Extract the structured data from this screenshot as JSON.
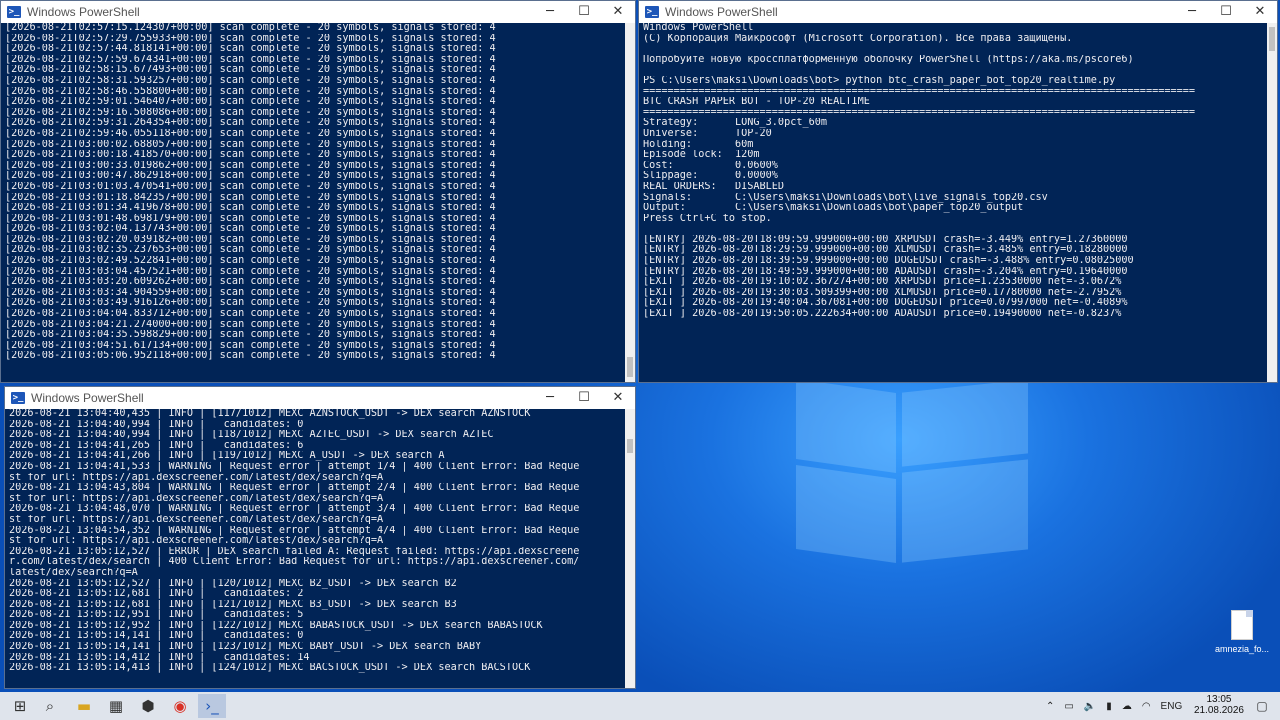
{
  "windows": {
    "w1": {
      "title": "Windows PowerShell",
      "lines": [
        "[2026-08-21T02:57:15.124307+00:00] scan complete - 20 symbols, signals stored: 4",
        "[2026-08-21T02:57:29.755933+00:00] scan complete - 20 symbols, signals stored: 4",
        "[2026-08-21T02:57:44.818141+00:00] scan complete - 20 symbols, signals stored: 4",
        "[2026-08-21T02:57:59.674341+00:00] scan complete - 20 symbols, signals stored: 4",
        "[2026-08-21T02:58:15.677493+00:00] scan complete - 20 symbols, signals stored: 4",
        "[2026-08-21T02:58:31.593257+00:00] scan complete - 20 symbols, signals stored: 4",
        "[2026-08-21T02:58:46.558800+00:00] scan complete - 20 symbols, signals stored: 4",
        "[2026-08-21T02:59:01.546407+00:00] scan complete - 20 symbols, signals stored: 4",
        "[2026-08-21T02:59:16.508086+00:00] scan complete - 20 symbols, signals stored: 4",
        "[2026-08-21T02:59:31.264354+00:00] scan complete - 20 symbols, signals stored: 4",
        "[2026-08-21T02:59:46.055118+00:00] scan complete - 20 symbols, signals stored: 4",
        "[2026-08-21T03:00:02.688057+00:00] scan complete - 20 symbols, signals stored: 4",
        "[2026-08-21T03:00:18.418570+00:00] scan complete - 20 symbols, signals stored: 4",
        "[2026-08-21T03:00:33.019862+00:00] scan complete - 20 symbols, signals stored: 4",
        "[2026-08-21T03:00:47.862918+00:00] scan complete - 20 symbols, signals stored: 4",
        "[2026-08-21T03:01:03.470541+00:00] scan complete - 20 symbols, signals stored: 4",
        "[2026-08-21T03:01:18.842357+00:00] scan complete - 20 symbols, signals stored: 4",
        "[2026-08-21T03:01:34.419678+00:00] scan complete - 20 symbols, signals stored: 4",
        "[2026-08-21T03:01:48.698179+00:00] scan complete - 20 symbols, signals stored: 4",
        "[2026-08-21T03:02:04.137743+00:00] scan complete - 20 symbols, signals stored: 4",
        "[2026-08-21T03:02:20.039182+00:00] scan complete - 20 symbols, signals stored: 4",
        "[2026-08-21T03:02:35.237653+00:00] scan complete - 20 symbols, signals stored: 4",
        "[2026-08-21T03:02:49.522841+00:00] scan complete - 20 symbols, signals stored: 4",
        "[2026-08-21T03:03:04.457521+00:00] scan complete - 20 symbols, signals stored: 4",
        "[2026-08-21T03:03:20.609262+00:00] scan complete - 20 symbols, signals stored: 4",
        "[2026-08-21T03:03:34.904559+00:00] scan complete - 20 symbols, signals stored: 4",
        "[2026-08-21T03:03:49.916126+00:00] scan complete - 20 symbols, signals stored: 4",
        "[2026-08-21T03:04:04.833712+00:00] scan complete - 20 symbols, signals stored: 4",
        "[2026-08-21T03:04:21.274000+00:00] scan complete - 20 symbols, signals stored: 4",
        "[2026-08-21T03:04:35.598829+00:00] scan complete - 20 symbols, signals stored: 4",
        "[2026-08-21T03:04:51.617134+00:00] scan complete - 20 symbols, signals stored: 4",
        "[2026-08-21T03:05:06.952118+00:00] scan complete - 20 symbols, signals stored: 4"
      ]
    },
    "w2": {
      "title": "Windows PowerShell",
      "lines": [
        "Windows PowerShell",
        "(C) Корпорация Майкрософт (Microsoft Corporation). Все права защищены.",
        "",
        "Попробуйте новую кроссплатформенную оболочку PowerShell (https://aka.ms/pscore6)",
        "",
        "PS C:\\Users\\maksi\\Downloads\\bot> python btc_crash_paper_bot_top20_realtime.py",
        "==========================================================================================",
        "BTC CRASH PAPER BOT - TOP-20 REALTIME",
        "==========================================================================================",
        "Strategy:      LONG_3.0pct_60m",
        "Universe:      TOP-20",
        "Holding:       60m",
        "Episode lock:  120m",
        "Cost:          0.0600%",
        "Slippage:      0.0000%",
        "REAL ORDERS:   DISABLED",
        "Signals:       C:\\Users\\maksi\\Downloads\\bot\\live_signals_top20.csv",
        "Output:        C:\\Users\\maksi\\Downloads\\bot\\paper_top20_output",
        "Press Ctrl+C to stop.",
        "",
        "[ENTRY] 2026-08-20T18:09:59.999000+00:00 XRPUSDT crash=-3.449% entry=1.27360000",
        "[ENTRY] 2026-08-20T18:29:59.999000+00:00 XLMUSDT crash=-3.485% entry=0.18280000",
        "[ENTRY] 2026-08-20T18:39:59.999000+00:00 DOGEUSDT crash=-3.488% entry=0.08025000",
        "[ENTRY] 2026-08-20T18:49:59.999000+00:00 ADAUSDT crash=-3.204% entry=0.19640000",
        "[EXIT ] 2026-08-20T19:10:02.367274+00:00 XRPUSDT price=1.23530000 net=-3.0672%",
        "[EXIT ] 2026-08-20T19:30:03.509399+00:00 XLMUSDT price=0.17780000 net=-2.7952%",
        "[EXIT ] 2026-08-20T19:40:04.367081+00:00 DOGEUSDT price=0.07997000 net=-0.4089%",
        "[EXIT ] 2026-08-20T19:50:05.222634+00:00 ADAUSDT price=0.19490000 net=-0.8237%"
      ]
    },
    "w3": {
      "title": "Windows PowerShell",
      "lines": [
        "2026-08-21 13:04:40,435 | INFO | [117/1012] MEXC AZNSTOCK_USDT -> DEX search AZNSTOCK",
        "2026-08-21 13:04:40,994 | INFO |   candidates: 0",
        "2026-08-21 13:04:40,994 | INFO | [118/1012] MEXC AZTEC_USDT -> DEX search AZTEC",
        "2026-08-21 13:04:41,265 | INFO |   candidates: 6",
        "2026-08-21 13:04:41,266 | INFO | [119/1012] MEXC A_USDT -> DEX search A",
        "2026-08-21 13:04:41,533 | WARNING | Request error | attempt 1/4 | 400 Client Error: Bad Reque",
        "st for url: https://api.dexscreener.com/latest/dex/search?q=A",
        "2026-08-21 13:04:43,804 | WARNING | Request error | attempt 2/4 | 400 Client Error: Bad Reque",
        "st for url: https://api.dexscreener.com/latest/dex/search?q=A",
        "2026-08-21 13:04:48,070 | WARNING | Request error | attempt 3/4 | 400 Client Error: Bad Reque",
        "st for url: https://api.dexscreener.com/latest/dex/search?q=A",
        "2026-08-21 13:04:54,352 | WARNING | Request error | attempt 4/4 | 400 Client Error: Bad Reque",
        "st for url: https://api.dexscreener.com/latest/dex/search?q=A",
        "2026-08-21 13:05:12,527 | ERROR | DEX search failed A: Request failed: https://api.dexscreene",
        "r.com/latest/dex/search | 400 Client Error: Bad Request for url: https://api.dexscreener.com/",
        "latest/dex/search?q=A",
        "2026-08-21 13:05:12,527 | INFO | [120/1012] MEXC B2_USDT -> DEX search B2",
        "2026-08-21 13:05:12,681 | INFO |   candidates: 2",
        "2026-08-21 13:05:12,681 | INFO | [121/1012] MEXC B3_USDT -> DEX search B3",
        "2026-08-21 13:05:12,951 | INFO |   candidates: 5",
        "2026-08-21 13:05:12,952 | INFO | [122/1012] MEXC BABASTOCK_USDT -> DEX search BABASTOCK",
        "2026-08-21 13:05:14,141 | INFO |   candidates: 0",
        "2026-08-21 13:05:14,141 | INFO | [123/1012] MEXC BABY_USDT -> DEX search BABY",
        "2026-08-21 13:05:14,412 | INFO |   candidates: 14",
        "2026-08-21 13:05:14,413 | INFO | [124/1012] MEXC BACSTOCK_USDT -> DEX search BACSTOCK",
        "",
        "_"
      ]
    }
  },
  "desktop": {
    "icon_label": "amnezia_fo..."
  },
  "taskbar": {
    "lang": "ENG",
    "time": "13:05",
    "date": "21.08.2026",
    "icons": [
      "windows-start-icon",
      "search-icon",
      "file-explorer-icon",
      "calculator-icon",
      "vpn-icon",
      "chrome-icon",
      "powershell-icon"
    ]
  },
  "colors": {
    "console_bg": "#012456",
    "console_fg": "#eeedf0",
    "taskbar_bg": "#dfe4ec"
  }
}
